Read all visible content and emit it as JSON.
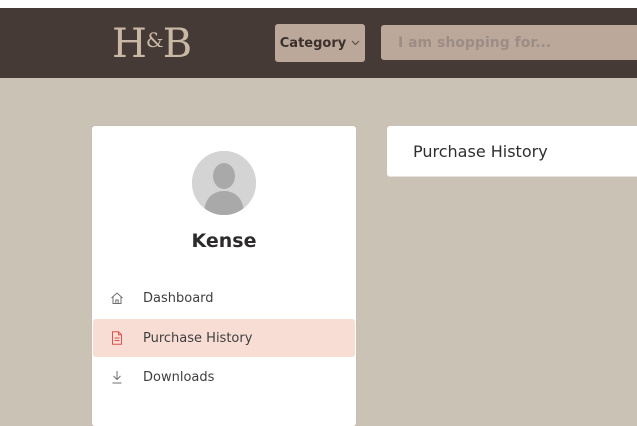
{
  "header": {
    "logo_text": "H&B",
    "category_label": "Category",
    "search_placeholder": "I am shopping for..."
  },
  "sidebar": {
    "username": "Kense",
    "items": [
      {
        "label": "Dashboard",
        "icon": "home-icon",
        "active": false
      },
      {
        "label": "Purchase History",
        "icon": "document-icon",
        "active": true
      },
      {
        "label": "Downloads",
        "icon": "download-icon",
        "active": false
      }
    ]
  },
  "main": {
    "title": "Purchase History"
  },
  "colors": {
    "header_bg": "#463a37",
    "page_bg": "#cbc2b6",
    "active_item_bg": "#f8ddd5",
    "active_icon": "#d9534f"
  }
}
